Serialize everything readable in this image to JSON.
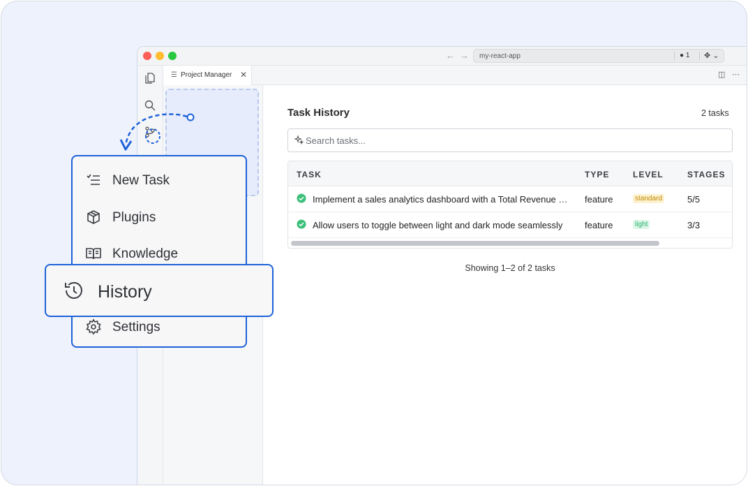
{
  "window": {
    "project_name": "my-react-app",
    "badge": "● 1"
  },
  "tab": {
    "label": "Project Manager"
  },
  "main": {
    "title": "Task History",
    "count": "2 tasks",
    "search_placeholder": "Search tasks...",
    "columns": [
      "TASK",
      "TYPE",
      "LEVEL",
      "STAGES"
    ],
    "rows": [
      {
        "task": "Implement a sales analytics dashboard with a Total Revenue card",
        "type": "feature",
        "level": "standard",
        "stages": "5/5"
      },
      {
        "task": "Allow users to toggle between light and dark mode seamlessly",
        "type": "feature",
        "level": "light",
        "stages": "3/3"
      }
    ],
    "footer": "Showing 1–2 of 2 tasks"
  },
  "menu": {
    "items": [
      {
        "label": "New Task",
        "icon": "list-plus-icon"
      },
      {
        "label": "Plugins",
        "icon": "package-icon"
      },
      {
        "label": "Knowledge",
        "icon": "book-open-icon"
      },
      {
        "label": "Settings",
        "icon": "gear-icon"
      }
    ],
    "highlighted": {
      "label": "History",
      "icon": "history-icon"
    }
  },
  "colors": {
    "accent": "#1d62d8",
    "success": "#3cc07a",
    "standard_badge_bg": "#fdf2cf",
    "standard_badge_text": "#c08a04",
    "light_badge_bg": "#dcf7e8",
    "light_badge_text": "#2fb170"
  }
}
